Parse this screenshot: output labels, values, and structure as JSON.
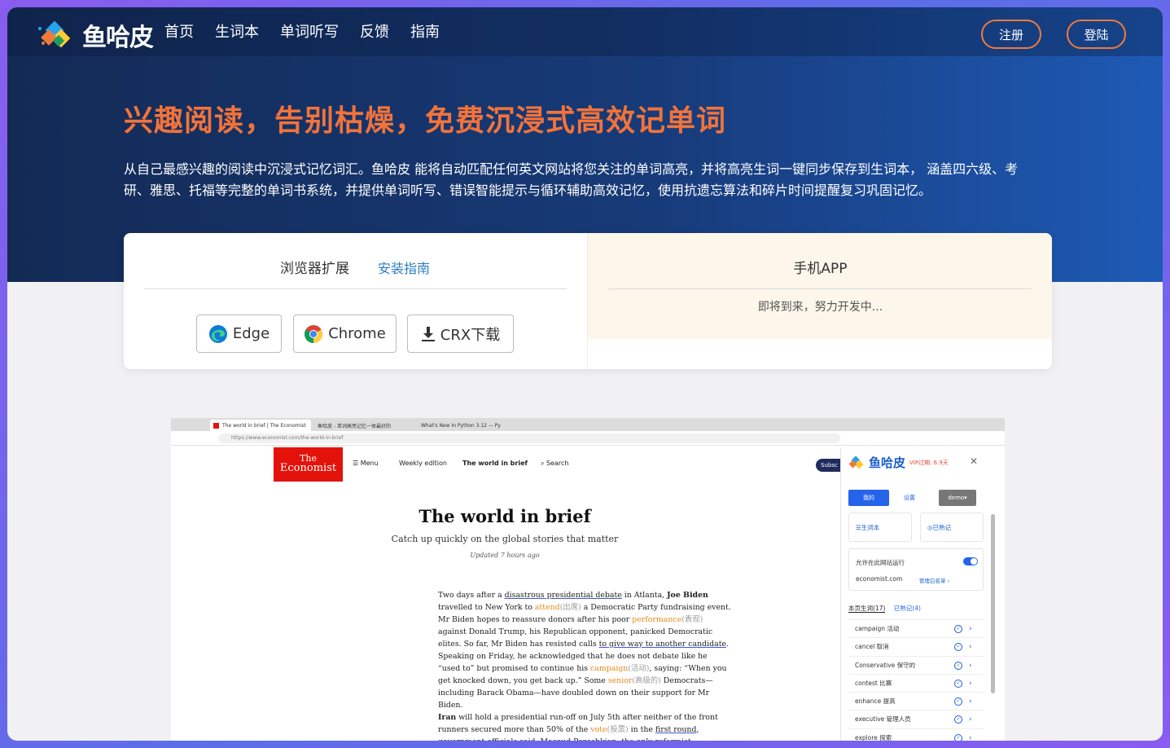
{
  "nav": {
    "logo_text": "鱼哈皮",
    "links": [
      "首页",
      "生词本",
      "单词听写",
      "反馈",
      "指南"
    ],
    "register": "注册",
    "login": "登陆"
  },
  "hero": {
    "headline": "兴趣阅读，告别枯燥，免费沉浸式高效记单词",
    "description": "从自己最感兴趣的阅读中沉浸式记忆词汇。鱼哈皮 能将自动匹配任何英文网站将您关注的单词高亮，并将高亮生词一键同步保存到生词本， 涵盖四六级、考研、雅思、托福等完整的单词书系统，并提供单词听写、错误智能提示与循环辅助高效记忆，使用抗遗忘算法和碎片时间提醒复习巩固记忆。"
  },
  "card": {
    "ext_title": "浏览器扩展",
    "install_guide": "安装指南",
    "buttons": [
      "Edge",
      "Chrome",
      "CRX下载"
    ],
    "app_title": "手机APP",
    "app_status": "即将到来，努力开发中..."
  },
  "screenshot": {
    "tabs": [
      "The world in brief | The Economist",
      "鱼哈皮 - 单词高亮记忆一体最好的",
      "What's New In Python 3.12 — Py"
    ],
    "url": "https://www.economist.com/the-world-in-brief",
    "econ_logo": [
      "The",
      "Economist"
    ],
    "econ_nav": [
      "Menu",
      "Weekly edition",
      "The world in brief",
      "Search"
    ],
    "subscribe": "Subsc",
    "article_title": "The world in brief",
    "article_sub": "Catch up quickly on the global stories that matter",
    "article_updated": "Updated 7 hours ago",
    "ext": {
      "logo_text": "鱼哈皮",
      "vip": "VIP过期: 6.9天",
      "tab_mine": "我的",
      "tab_settings": "设置",
      "tab_user": "demo",
      "wordbook": "生词本",
      "remembered": "已熟记",
      "allow_site": "允许在此网站运行",
      "site": "economist.com",
      "whitelist": "管理白名单",
      "page_words": "本页生词(17)",
      "page_remembered": "已熟记(4)",
      "words": [
        "campaign 活动",
        "cancel 取消",
        "Conservative 保守的",
        "contest 比赛",
        "enhance 提高",
        "executive 管理人员",
        "explore 探索"
      ]
    }
  }
}
